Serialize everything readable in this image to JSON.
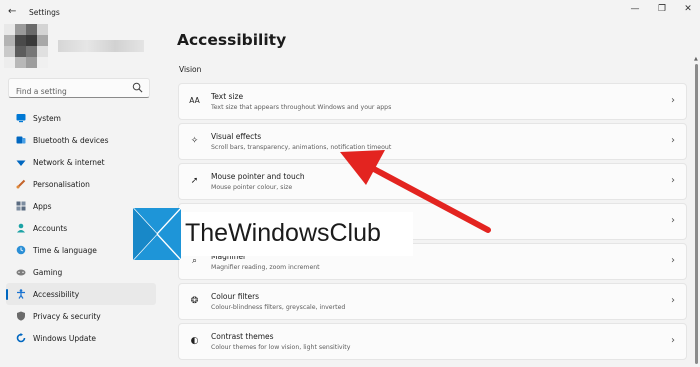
{
  "window": {
    "title": "Settings",
    "back_glyph": "←",
    "minimize_glyph": "—",
    "maximize_glyph": "❐",
    "close_glyph": "✕"
  },
  "search": {
    "placeholder": "Find a setting"
  },
  "sidebar": {
    "items": [
      {
        "label": "System",
        "icon": "monitor-icon",
        "color": "#0078d4"
      },
      {
        "label": "Bluetooth & devices",
        "icon": "bluetooth-icon",
        "color": "#0067c0"
      },
      {
        "label": "Network & internet",
        "icon": "wifi-icon",
        "color": "#0067c0"
      },
      {
        "label": "Personalisation",
        "icon": "brush-icon",
        "color": "#c4632a"
      },
      {
        "label": "Apps",
        "icon": "apps-icon",
        "color": "#5a6b80"
      },
      {
        "label": "Accounts",
        "icon": "person-icon",
        "color": "#1ba2a5"
      },
      {
        "label": "Time & language",
        "icon": "globe-clock-icon",
        "color": "#2b8fd6"
      },
      {
        "label": "Gaming",
        "icon": "controller-icon",
        "color": "#7d7d7d"
      },
      {
        "label": "Accessibility",
        "icon": "accessibility-icon",
        "color": "#1a73d1",
        "active": true
      },
      {
        "label": "Privacy & security",
        "icon": "shield-icon",
        "color": "#6b6b6b"
      },
      {
        "label": "Windows Update",
        "icon": "update-icon",
        "color": "#0067c0"
      }
    ]
  },
  "main": {
    "title": "Accessibility",
    "section": "Vision",
    "cards": [
      {
        "title": "Text size",
        "subtitle": "Text size that appears throughout Windows and your apps",
        "icon": "text-size-icon",
        "glyph": "AA"
      },
      {
        "title": "Visual effects",
        "subtitle": "Scroll bars, transparency, animations, notification timeout",
        "icon": "sparkle-icon",
        "glyph": "✧"
      },
      {
        "title": "Mouse pointer and touch",
        "subtitle": "Mouse pointer colour, size",
        "icon": "pointer-icon",
        "glyph": "➚"
      },
      {
        "title": "",
        "subtitle": "",
        "icon": "text-cursor-icon",
        "glyph": ""
      },
      {
        "title": "Magnifier",
        "subtitle": "Magnifier reading, zoom increment",
        "icon": "magnifier-icon",
        "glyph": "⌕"
      },
      {
        "title": "Colour filters",
        "subtitle": "Colour-blindness filters, greyscale, inverted",
        "icon": "color-filter-icon",
        "glyph": "❂"
      },
      {
        "title": "Contrast themes",
        "subtitle": "Colour themes for low vision, light sensitivity",
        "icon": "contrast-icon",
        "glyph": "◐"
      }
    ],
    "chevron_glyph": "›"
  },
  "watermark": {
    "text": "TheWindowsClub"
  },
  "colors": {
    "accent": "#0067c0",
    "annotation_arrow": "#e32420"
  }
}
